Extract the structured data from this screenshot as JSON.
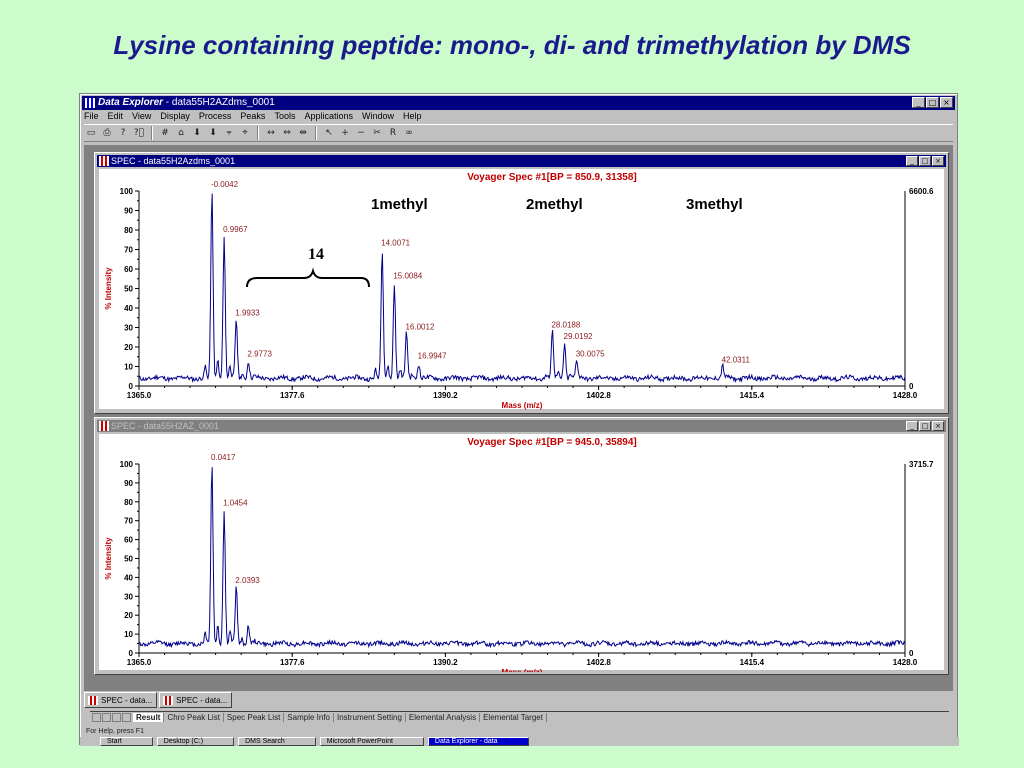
{
  "slide_title": "Lysine containing peptide: mono-, di- and trimethylation by DMS",
  "app": {
    "title_italic": "Data Explorer",
    "title_rest": " - data55H2AZdms_0001",
    "menu": [
      "File",
      "Edit",
      "View",
      "Display",
      "Process",
      "Peaks",
      "Tools",
      "Applications",
      "Window",
      "Help"
    ],
    "win_buttons": [
      "_",
      "□",
      "×"
    ]
  },
  "toolbar_icons": [
    "open-icon",
    "print-icon",
    "help-icon",
    "context-help-icon",
    "grid-icon",
    "peak-icon",
    "arrow-down-icon",
    "arrow-down2-icon",
    "ruler-icon",
    "label-icon",
    "zoom-in-icon",
    "zoom-center-icon",
    "zoom-out-icon",
    "pointer-icon",
    "plus-icon",
    "minus-icon",
    "scissors-icon",
    "ra-icon",
    "link-icon"
  ],
  "toolbar_glyphs": [
    "▭",
    "⎙",
    "?",
    "?⃝",
    "#",
    "⌂",
    "⬇",
    "⬇",
    "⫧",
    "⌖",
    "↔",
    "⇔",
    "⇹",
    "↖",
    "+",
    "−",
    "✂",
    "R",
    "∞"
  ],
  "spectra": [
    {
      "window_title": "SPEC - data55H2Azdms_0001",
      "state": "active",
      "header": "Voyager Spec #1[BP = 850.9, 31358]",
      "right_max": "6600.6",
      "right_min": "0",
      "annotations": [
        "1methyl",
        "2methyl",
        "3methyl",
        "14"
      ]
    },
    {
      "window_title": "SPEC - data55H2AZ_0001",
      "state": "inactive",
      "header": "Voyager Spec #1[BP = 945.0, 35894]",
      "right_max": "3715.7",
      "right_min": "0",
      "annotations": []
    }
  ],
  "chart_data": [
    {
      "type": "line",
      "title": "Voyager Spec #1[BP = 850.9, 31358]",
      "xlabel": "Mass (m/z)",
      "ylabel": "% Intensity",
      "xlim": [
        1365.0,
        1428.0
      ],
      "ylim": [
        0,
        100
      ],
      "xticks": [
        "1365.0",
        "1377.6",
        "1390.2",
        "1402.8",
        "1415.4",
        "1428.0"
      ],
      "yticks": [
        "0",
        "10",
        "20",
        "30",
        "40",
        "50",
        "60",
        "70",
        "80",
        "90",
        "100"
      ],
      "peaks": [
        {
          "x": 1371.0,
          "y": 100,
          "label": "-0.0042"
        },
        {
          "x": 1372.0,
          "y": 77,
          "label": "0.9967"
        },
        {
          "x": 1373.0,
          "y": 34,
          "label": "1.9933"
        },
        {
          "x": 1374.0,
          "y": 13,
          "label": "2.9773"
        },
        {
          "x": 1385.0,
          "y": 70,
          "label": "14.0071"
        },
        {
          "x": 1386.0,
          "y": 53,
          "label": "15.0084"
        },
        {
          "x": 1387.0,
          "y": 27,
          "label": "16.0012"
        },
        {
          "x": 1388.0,
          "y": 12,
          "label": "16.9947"
        },
        {
          "x": 1399.0,
          "y": 28,
          "label": "28.0188"
        },
        {
          "x": 1400.0,
          "y": 22,
          "label": "29.0192"
        },
        {
          "x": 1401.0,
          "y": 13,
          "label": "30.0075"
        },
        {
          "x": 1413.0,
          "y": 10,
          "label": "42.0311"
        }
      ],
      "baseline": 4,
      "color": "#00008b"
    },
    {
      "type": "line",
      "title": "Voyager Spec #1[BP = 945.0, 35894]",
      "xlabel": "Mass (m/z)",
      "ylabel": "% Intensity",
      "xlim": [
        1365.0,
        1428.0
      ],
      "ylim": [
        0,
        100
      ],
      "xticks": [
        "1365.0",
        "1377.6",
        "1390.2",
        "1402.8",
        "1415.4",
        "1428.0"
      ],
      "yticks": [
        "0",
        "10",
        "20",
        "30",
        "40",
        "50",
        "60",
        "70",
        "80",
        "90",
        "100"
      ],
      "peaks": [
        {
          "x": 1371.0,
          "y": 100,
          "label": "0.0417"
        },
        {
          "x": 1372.0,
          "y": 76,
          "label": "1.0454"
        },
        {
          "x": 1373.0,
          "y": 35,
          "label": "2.0393"
        },
        {
          "x": 1374.0,
          "y": 15,
          "label": ""
        }
      ],
      "baseline": 5,
      "color": "#00008b"
    }
  ],
  "mdi_tabs": [
    "SPEC - data...",
    "SPEC - data..."
  ],
  "result_tabs": [
    "Result",
    "Chro Peak List",
    "Spec Peak List",
    "Sample Info",
    "Instrument Setting",
    "Elemental Analysis",
    "Elemental Target"
  ],
  "status_text": "For Help, press F1",
  "taskbar": [
    "Start",
    "Desktop (C:)",
    "DMS Search",
    "Microsoft PowerPoint",
    "Data Explorer - data"
  ]
}
